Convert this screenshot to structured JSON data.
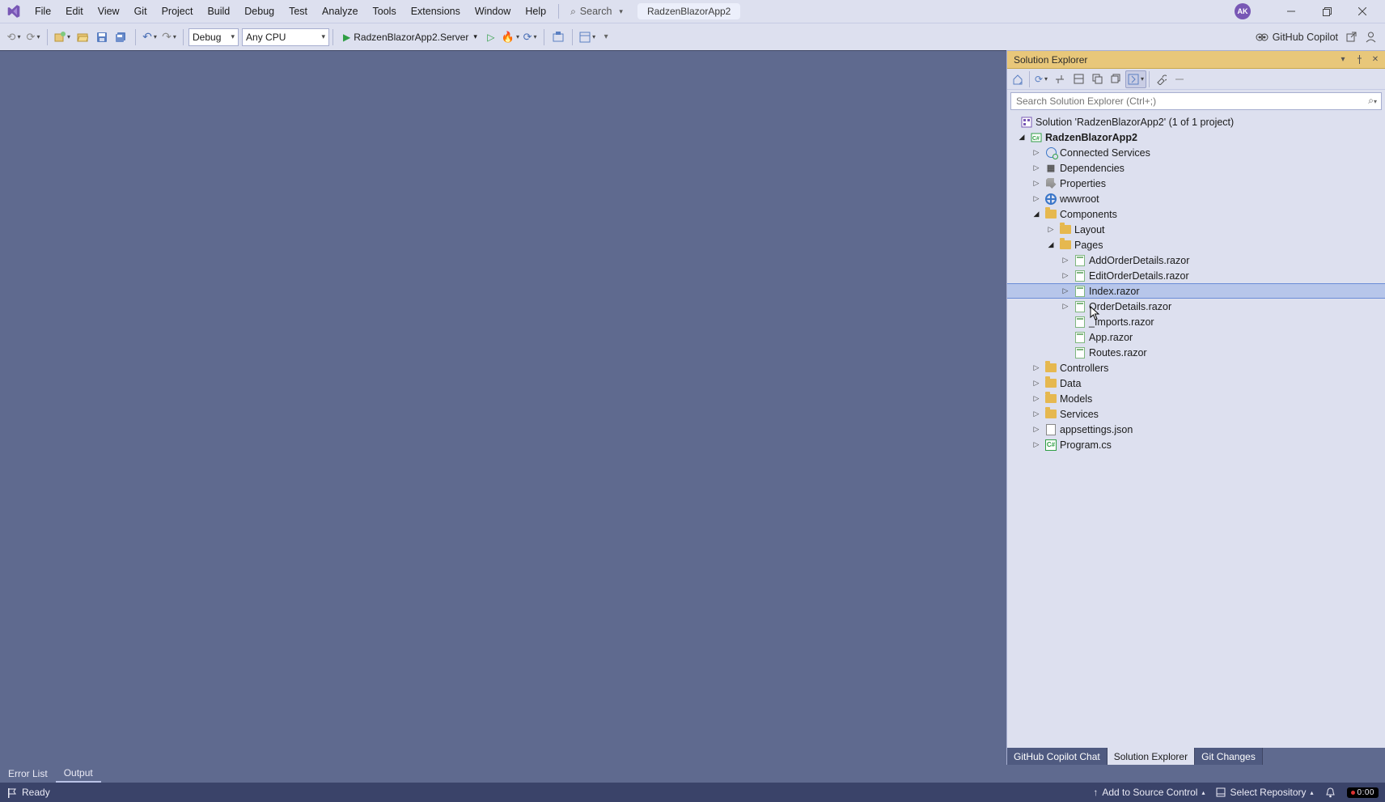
{
  "menu": [
    "File",
    "Edit",
    "View",
    "Git",
    "Project",
    "Build",
    "Debug",
    "Test",
    "Analyze",
    "Tools",
    "Extensions",
    "Window",
    "Help"
  ],
  "search": {
    "label": "Search"
  },
  "titleTab": "RadzenBlazorApp2",
  "avatar": "AK",
  "toolbar": {
    "configCombo": "Debug",
    "platformCombo": "Any CPU",
    "startTarget": "RadzenBlazorApp2.Server"
  },
  "copilot": "GitHub Copilot",
  "panel": {
    "title": "Solution Explorer",
    "searchPlaceholder": "Search Solution Explorer (Ctrl+;)"
  },
  "tree": {
    "solution": "Solution 'RadzenBlazorApp2' (1 of 1 project)",
    "project": "RadzenBlazorApp2",
    "connectedServices": "Connected Services",
    "dependencies": "Dependencies",
    "properties": "Properties",
    "wwwroot": "wwwroot",
    "components": "Components",
    "layout": "Layout",
    "pages": "Pages",
    "files": {
      "addOrder": "AddOrderDetails.razor",
      "editOrder": "EditOrderDetails.razor",
      "index": "Index.razor",
      "orderDetails": "OrderDetails.razor",
      "imports": "_Imports.razor",
      "app": "App.razor",
      "routes": "Routes.razor"
    },
    "controllers": "Controllers",
    "data": "Data",
    "models": "Models",
    "services": "Services",
    "appsettings": "appsettings.json",
    "program": "Program.cs"
  },
  "panelTabs": {
    "chat": "GitHub Copilot Chat",
    "sol": "Solution Explorer",
    "git": "Git Changes"
  },
  "bottomTabs": {
    "errors": "Error List",
    "output": "Output"
  },
  "status": {
    "ready": "Ready",
    "addSource": "Add to Source Control",
    "selectRepo": "Select Repository",
    "time": "0:00"
  }
}
